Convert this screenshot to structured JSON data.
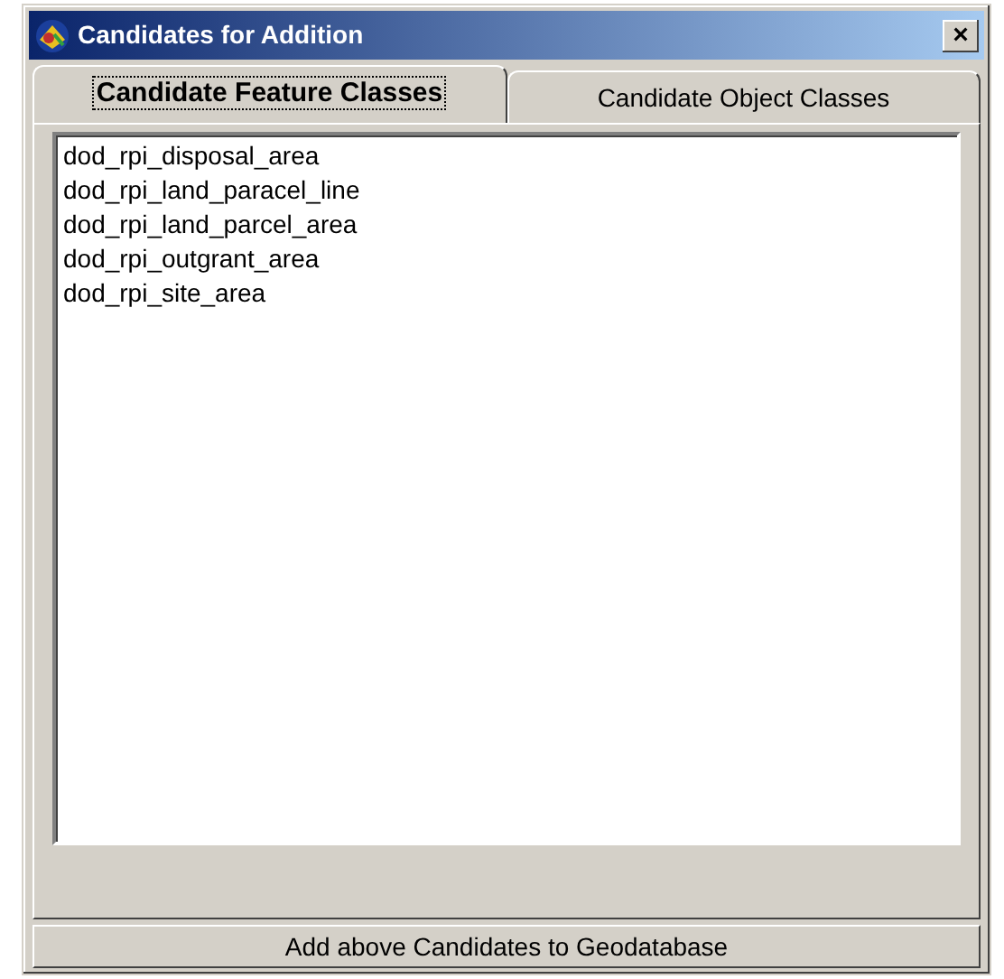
{
  "window": {
    "title": "Candidates for Addition",
    "close": "×"
  },
  "tabs": [
    {
      "label": "Candidate Feature Classes",
      "selected": true
    },
    {
      "label": "Candidate Object Classes",
      "selected": false
    }
  ],
  "list": {
    "items": [
      "dod_rpi_disposal_area",
      "dod_rpi_land_paracel_line",
      "dod_rpi_land_parcel_area",
      "dod_rpi_outgrant_area",
      "dod_rpi_site_area"
    ]
  },
  "button": {
    "label": "Add above Candidates to Geodatabase"
  }
}
